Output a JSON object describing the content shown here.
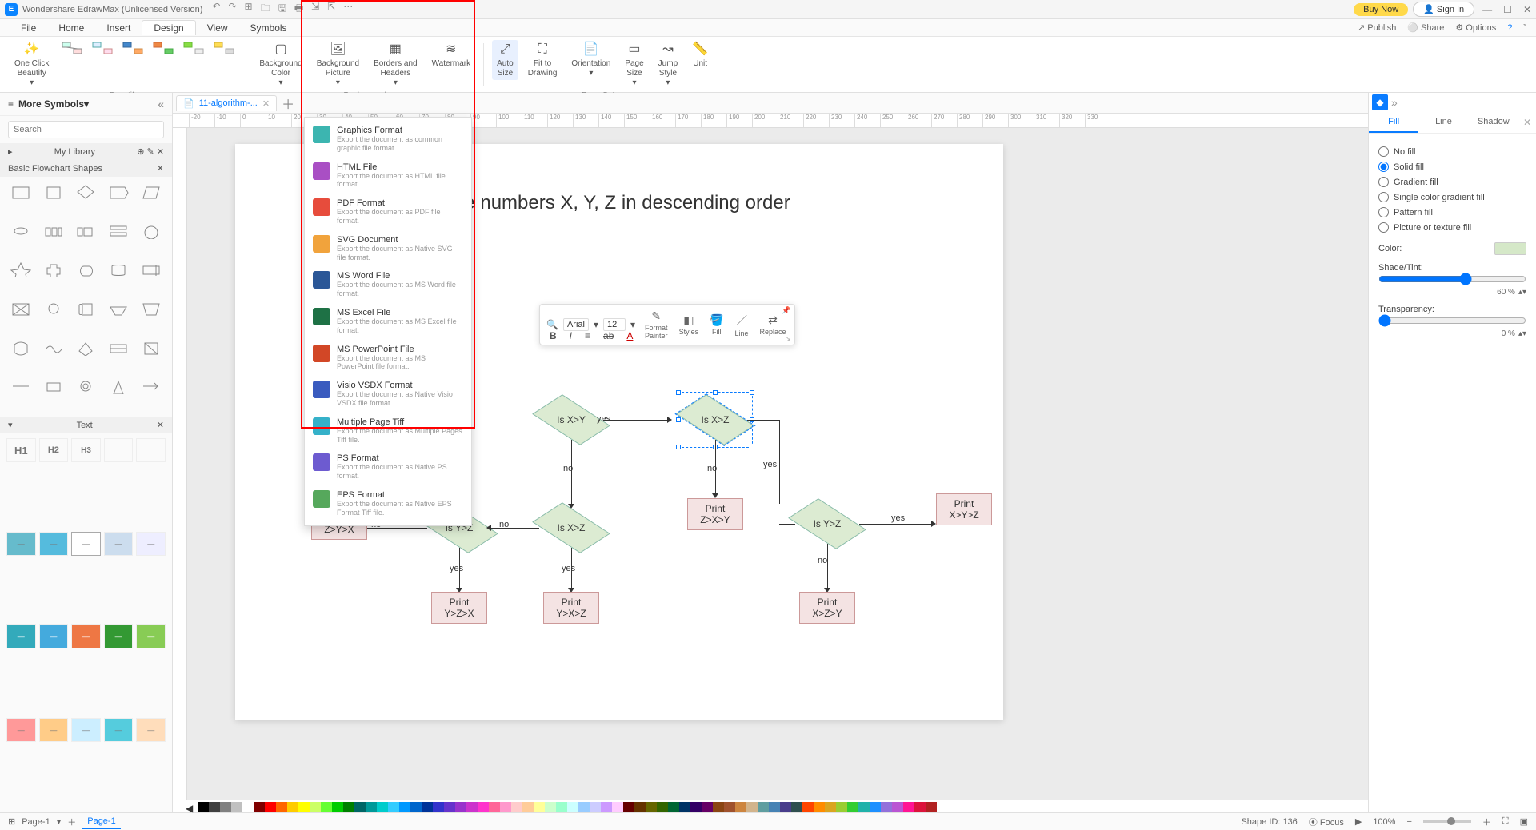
{
  "app": {
    "title": "Wondershare EdrawMax (Unlicensed Version)",
    "buy": "Buy Now",
    "signin": "Sign In"
  },
  "menus": {
    "items": [
      "File",
      "Home",
      "Insert",
      "Design",
      "View",
      "Symbols"
    ],
    "active": "Design",
    "right": {
      "publish": "Publish",
      "share": "Share",
      "options": "Options"
    }
  },
  "ribbon": {
    "beautify_btn": "One Click\nBeautify",
    "beautify_group": "Beautify",
    "bg_color": "Background\nColor",
    "bg_pic": "Background\nPicture",
    "borders": "Borders and\nHeaders",
    "watermark": "Watermark",
    "background_group": "Background",
    "auto_size": "Auto\nSize",
    "fit": "Fit to\nDrawing",
    "orientation": "Orientation",
    "page_size": "Page\nSize",
    "jump_style": "Jump\nStyle",
    "unit": "Unit",
    "pagesetup_group": "Page Setup"
  },
  "left": {
    "more_symbols": "More Symbols",
    "search_ph": "Search",
    "my_library": "My Library",
    "basic_shapes": "Basic Flowchart Shapes",
    "text_hdr": "Text",
    "headings": [
      "H1",
      "H2",
      "H3",
      "",
      "",
      "",
      "",
      "",
      "",
      "",
      "",
      "",
      "",
      "",
      "",
      "",
      "",
      "",
      "",
      ""
    ]
  },
  "doc": {
    "tab": "11-algorithm-...",
    "page_title": "the numbers X, Y, Z in descending order"
  },
  "ruler": [
    "-20",
    "-10",
    "0",
    "10",
    "20",
    "30",
    "40",
    "50",
    "60",
    "70",
    "80",
    "90",
    "100",
    "110",
    "120",
    "130",
    "140",
    "150",
    "160",
    "170",
    "180",
    "190",
    "200",
    "210",
    "220",
    "230",
    "240",
    "250",
    "260",
    "270",
    "280",
    "290",
    "300",
    "310",
    "320",
    "330"
  ],
  "flow": {
    "d1": "Is X>Y",
    "d1_yes": "yes",
    "d1_no": "no",
    "d2": "Is X>Z",
    "d2_no": "no",
    "d2_yes": "yes",
    "d3": "Is Y>Z",
    "d3_yes": "yes",
    "d3_no": "no",
    "d4": "Is X>Z",
    "d4_yes": "yes",
    "d4_no": "no",
    "d5": "Is Y>Z",
    "d5_yes": "yes",
    "d5_no": "no",
    "p1": "Print\nZ>Y>X",
    "p2": "Print\nY>Z>X",
    "p3": "Print\nY>X>Z",
    "p4": "Print\nZ>X>Y",
    "p5": "Print\nX>Z>Y",
    "p6": "Print\nX>Y>Z"
  },
  "float": {
    "font": "Arial",
    "size": "12",
    "format_painter": "Format\nPainter",
    "styles": "Styles",
    "fill": "Fill",
    "line": "Line",
    "replace": "Replace"
  },
  "export_items": [
    {
      "t": "Graphics Format",
      "d": "Export the document as common graphic file format.",
      "c": "#3cb5b0"
    },
    {
      "t": "HTML File",
      "d": "Export the document as HTML file format.",
      "c": "#a94fc4"
    },
    {
      "t": "PDF Format",
      "d": "Export the document as PDF file format.",
      "c": "#e74c3c"
    },
    {
      "t": "SVG Document",
      "d": "Export the document as Native SVG file format.",
      "c": "#f1a33c"
    },
    {
      "t": "MS Word File",
      "d": "Export the document as MS Word file format.",
      "c": "#2b5797"
    },
    {
      "t": "MS Excel File",
      "d": "Export the document as MS Excel file format.",
      "c": "#1e7145"
    },
    {
      "t": "MS PowerPoint File",
      "d": "Export the document as MS PowerPoint file format.",
      "c": "#d24726"
    },
    {
      "t": "Visio VSDX Format",
      "d": "Export the document as Native Visio VSDX file format.",
      "c": "#3a5bbf"
    },
    {
      "t": "Multiple Page Tiff",
      "d": "Export the document as Multiple Pages Tiff file.",
      "c": "#35b1c9"
    },
    {
      "t": "PS Format",
      "d": "Export the document as Native PS format.",
      "c": "#6d5bd0"
    },
    {
      "t": "EPS Format",
      "d": "Export the document as Native EPS Format Tiff file.",
      "c": "#56a85c"
    }
  ],
  "right": {
    "tabs": {
      "fill": "Fill",
      "line": "Line",
      "shadow": "Shadow"
    },
    "opts": {
      "none": "No fill",
      "solid": "Solid fill",
      "grad": "Gradient fill",
      "scg": "Single color gradient fill",
      "pat": "Pattern fill",
      "pic": "Picture or texture fill"
    },
    "color": "Color:",
    "shade": "Shade/Tint:",
    "shade_val": "60 %",
    "transp": "Transparency:",
    "transp_val": "0 %"
  },
  "colors": [
    "#000000",
    "#404040",
    "#808080",
    "#c0c0c0",
    "#ffffff",
    "#800000",
    "#ff0000",
    "#ff6600",
    "#ffcc00",
    "#ffff00",
    "#ccff66",
    "#66ff33",
    "#00cc00",
    "#008000",
    "#006666",
    "#009999",
    "#00cccc",
    "#33ccff",
    "#0099ff",
    "#0066cc",
    "#003399",
    "#3333cc",
    "#6633cc",
    "#9933cc",
    "#cc33cc",
    "#ff33cc",
    "#ff6699",
    "#ff99cc",
    "#ffcccc",
    "#ffcc99",
    "#ffff99",
    "#ccffcc",
    "#99ffcc",
    "#ccffff",
    "#99ccff",
    "#ccccff",
    "#cc99ff",
    "#ffccff",
    "#660000",
    "#663300",
    "#666600",
    "#336600",
    "#006633",
    "#003366",
    "#330066",
    "#660066",
    "#8b4513",
    "#a0522d",
    "#cd853f",
    "#d2b48c",
    "#5f9ea0",
    "#4682b4",
    "#483d8b",
    "#2f4f4f",
    "#ff4500",
    "#ff8c00",
    "#daa520",
    "#9acd32",
    "#32cd32",
    "#20b2aa",
    "#1e90ff",
    "#9370db",
    "#ba55d3",
    "#ff1493",
    "#dc143c",
    "#b22222"
  ],
  "status": {
    "page_label": "Page-1",
    "page_tab": "Page-1",
    "shape_id": "Shape ID: 136",
    "focus": "Focus",
    "zoom": "100%"
  }
}
